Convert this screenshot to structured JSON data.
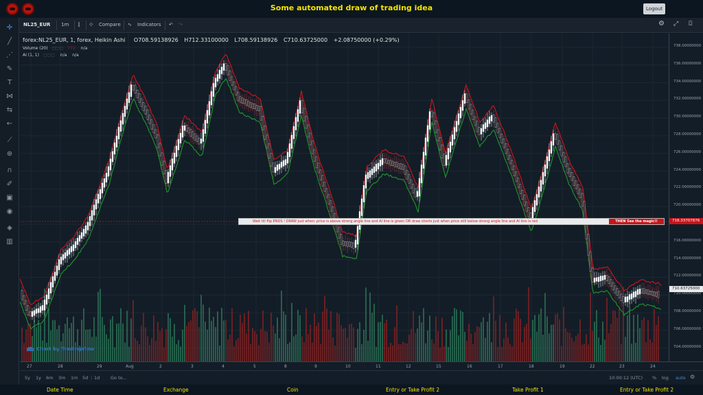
{
  "header": {
    "title": "Some automated draw of trading idea",
    "logout_label": "Logout"
  },
  "toolbar": {
    "symbol": "NL25_EUR",
    "interval": "1m",
    "compare_label": "Compare",
    "indicators_label": "Indicators"
  },
  "legend": {
    "main": "forex:NL25_EUR, 1, forex, Heikin Ashi",
    "open": "O708.59138926",
    "high": "H712.33100000",
    "low": "L708.59138926",
    "close": "C710.63725000",
    "change": "+2.08750000 (+0.29%)",
    "volume_label": "Volume (20)",
    "volume_value": "772",
    "volume_extra": "n/a",
    "ai_label": "AI (1, 1)",
    "ai_value": "n/a",
    "ai_extra": "n/a"
  },
  "banner": {
    "message": "Wait till flip ENDS  !    DRAW just when:  price is above strong angle line and AI line is green        OR        draw shorts just when price still below strong angle line and AI line is red",
    "magic": "THEN See the magic!!"
  },
  "watermark": "Chart by TradingView",
  "price_axis": {
    "ticks": [
      "738.00000000",
      "736.00000000",
      "734.00000000",
      "732.00000000",
      "730.00000000",
      "728.00000000",
      "726.00000000",
      "724.00000000",
      "722.00000000",
      "720.00000000",
      "718.00000000",
      "716.00000000",
      "714.00000000",
      "712.00000000",
      "710.00000000",
      "708.00000000",
      "706.00000000",
      "704.00000000"
    ],
    "line_price_tag": "718.33707876",
    "current_price_tag": "710.63725000"
  },
  "time_axis": {
    "labels": [
      "27",
      "28",
      "29",
      "Aug",
      "2",
      "3",
      "4",
      "5",
      "8",
      "9",
      "10",
      "11",
      "12",
      "15",
      "16",
      "17",
      "18",
      "19",
      "22",
      "23",
      "24"
    ]
  },
  "bottom": {
    "ranges": [
      "5y",
      "1y",
      "6m",
      "3m",
      "1m",
      "5d",
      "1d"
    ],
    "goto_label": "Go to...",
    "clock": "10:00:12 (UTC)",
    "percent_label": "%",
    "log_label": "log",
    "auto_label": "auto"
  },
  "footer": {
    "columns": [
      "Date Time",
      "Exchange",
      "Coin",
      "Entry or Take Profit 2",
      "Take Profit 1",
      "Entry or Take Profit 2"
    ]
  },
  "colors": {
    "up": "#2e7d5b",
    "down": "#8e2222",
    "ai_green": "#1f8f2a",
    "ai_red": "#c0171d",
    "accent": "#f4e400"
  }
}
